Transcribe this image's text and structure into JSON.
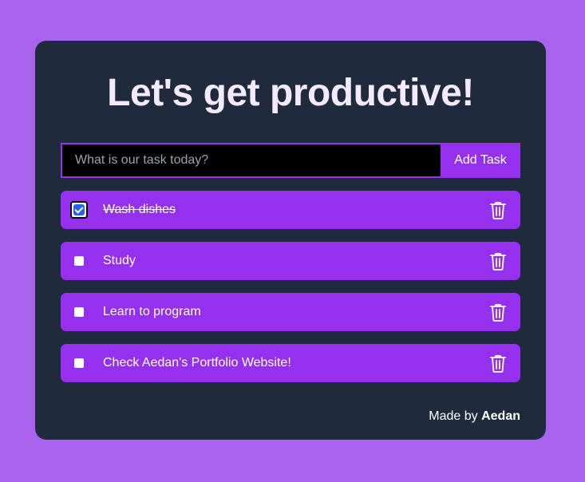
{
  "header": {
    "title": "Let's get productive!"
  },
  "new_task": {
    "placeholder": "What is our task today?",
    "value": "",
    "add_label": "Add Task"
  },
  "tasks": [
    {
      "label": "Wash dishes",
      "done": true
    },
    {
      "label": "Study",
      "done": false
    },
    {
      "label": "Learn to program",
      "done": false
    },
    {
      "label": "Check Aedan's Portfolio Website!",
      "done": false
    }
  ],
  "footer": {
    "prefix": "Made by",
    "author": "Aedan"
  },
  "colors": {
    "background": "#a963ec",
    "card": "#1f2a3c",
    "accent": "#9530ee",
    "title": "#f3eaff"
  },
  "icons": {
    "delete": "trash-icon",
    "complete": "checkbox-icon"
  }
}
